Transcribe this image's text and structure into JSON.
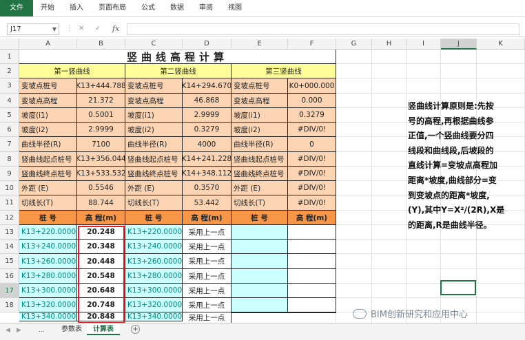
{
  "ribbon": {
    "tabs": [
      "文件",
      "开始",
      "插入",
      "页面布局",
      "公式",
      "数据",
      "审阅",
      "视图"
    ]
  },
  "formula_bar": {
    "name_box": "J17",
    "formula": ""
  },
  "columns": [
    "A",
    "B",
    "C",
    "D",
    "E",
    "F",
    "G",
    "H",
    "I",
    "J",
    "K"
  ],
  "rows": [
    "1",
    "2",
    "3",
    "4",
    "5",
    "6",
    "7",
    "8",
    "9",
    "10",
    "11",
    "12",
    "13",
    "14",
    "15",
    "16",
    "17",
    "18"
  ],
  "title": "竖曲线高程计算",
  "curve_headers": [
    "第一竖曲线",
    "第二竖曲线",
    "第三竖曲线"
  ],
  "params": [
    {
      "label": "变坡点桩号",
      "v1": "K13+444.788",
      "v2": "K14+294.670",
      "v3": "K0+000.000"
    },
    {
      "label": "变坡点高程",
      "v1": "21.372",
      "v2": "46.868",
      "v3": "0.000"
    },
    {
      "label": "坡度(i1)",
      "v1": "0.5001",
      "v2": "2.9999",
      "v3": "0.3279"
    },
    {
      "label": "坡度(i2)",
      "v1": "2.9999",
      "v2": "0.3279",
      "v3": "#DIV/0!"
    },
    {
      "label": "曲线半径(R)",
      "v1": "7100",
      "v2": "4000",
      "v3": "0"
    },
    {
      "label": "竖曲线起点桩号",
      "v1": "K13+356.044",
      "v2": "K14+241.228",
      "v3": "#DIV/0!"
    },
    {
      "label": "竖曲线终点桩号",
      "v1": "K13+533.532",
      "v2": "K14+348.112",
      "v3": "#DIV/0!"
    },
    {
      "label": "外距 (E)",
      "v1": "0.5546",
      "v2": "0.3570",
      "v3": "#DIV/0!"
    },
    {
      "label": "切线长(T)",
      "v1": "88.744",
      "v2": "53.442",
      "v3": "#DIV/0!"
    }
  ],
  "result_header": {
    "station": "桩  号",
    "elevation": "高 程(m)"
  },
  "results": [
    {
      "s1": "K13+220.0000",
      "e1": "20.248",
      "s2": "K13+220.0000",
      "e2": "采用上一点"
    },
    {
      "s1": "K13+240.0000",
      "e1": "20.348",
      "s2": "K13+240.0000",
      "e2": "采用上一点"
    },
    {
      "s1": "K13+260.0000",
      "e1": "20.448",
      "s2": "K13+260.0000",
      "e2": "采用上一点"
    },
    {
      "s1": "K13+280.0000",
      "e1": "20.548",
      "s2": "K13+280.0000",
      "e2": "采用上一点"
    },
    {
      "s1": "K13+300.0000",
      "e1": "20.648",
      "s2": "K13+300.0000",
      "e2": "采用上一点"
    },
    {
      "s1": "K13+320.0000",
      "e1": "20.748",
      "s2": "K13+320.0000",
      "e2": "采用上一点"
    },
    {
      "s1": "K13+340.0000",
      "e1": "20.848",
      "s2": "K13+340.0000",
      "e2": "采用上一点"
    }
  ],
  "note_lines": [
    "竖曲线计算原则是:先按",
    "号的高程,再根据曲线参",
    "正值,一个竖曲线要分四",
    "线段和曲线段,后坡段的",
    "直线计算=变坡点高程加",
    "距离*坡度,曲线部分=变",
    "到变坡点的距离*坡度,",
    "(Y),其中Y=X²/(2R),X是",
    "的距离,R是曲线半径。"
  ],
  "sheets": [
    "参数表",
    "计算表"
  ],
  "active_sheet": "计算表",
  "watermark": "BIM创新研究和应用中心",
  "colors": {
    "accent": "#217346",
    "tan": "#fbd4b4",
    "yellow": "#ffff99",
    "orange": "#f79646",
    "cyan": "#ccffff",
    "highlight": "#e02020"
  }
}
